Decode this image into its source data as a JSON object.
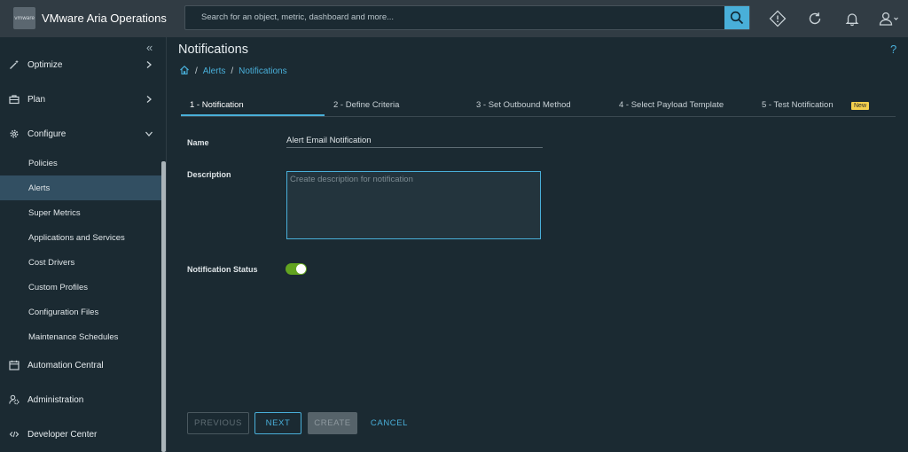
{
  "header": {
    "logo_text": "vmware",
    "app_title": "VMware Aria Operations",
    "search_placeholder": "Search for an object, metric, dashboard and more...",
    "icons": [
      "search-icon",
      "alert-diamond-icon",
      "refresh-icon",
      "bell-icon",
      "user-icon"
    ]
  },
  "sidebar": {
    "collapse_glyph": "«",
    "items": [
      {
        "label": "Optimize",
        "icon": "wand-icon",
        "chevron": "right"
      },
      {
        "label": "Plan",
        "icon": "briefcase-icon",
        "chevron": "right"
      },
      {
        "label": "Configure",
        "icon": "gear-icon",
        "chevron": "down"
      }
    ],
    "configure_children": [
      {
        "label": "Policies"
      },
      {
        "label": "Alerts",
        "active": true
      },
      {
        "label": "Super Metrics"
      },
      {
        "label": "Applications and Services"
      },
      {
        "label": "Cost Drivers"
      },
      {
        "label": "Custom Profiles"
      },
      {
        "label": "Configuration Files"
      },
      {
        "label": "Maintenance Schedules"
      }
    ],
    "bottom_items": [
      {
        "label": "Automation Central",
        "icon": "calendar-icon"
      },
      {
        "label": "Administration",
        "icon": "admin-gear-icon"
      },
      {
        "label": "Developer Center",
        "icon": "code-icon"
      }
    ]
  },
  "main": {
    "page_title": "Notifications",
    "help_glyph": "?",
    "breadcrumb": {
      "sep": "/",
      "items": [
        "Alerts",
        "Notifications"
      ]
    },
    "steps": [
      {
        "label": "1 - Notification",
        "active": true
      },
      {
        "label": "2 - Define Criteria"
      },
      {
        "label": "3 - Set Outbound Method"
      },
      {
        "label": "4 - Select Payload Template"
      },
      {
        "label": "5 - Test Notification",
        "badge": "New"
      }
    ],
    "form": {
      "name_label": "Name",
      "name_value": "Alert Email Notification",
      "description_label": "Description",
      "description_placeholder": "Create description for notification",
      "status_label": "Notification Status",
      "status_on": true
    },
    "buttons": {
      "previous": "PREVIOUS",
      "next": "NEXT",
      "create": "CREATE",
      "cancel": "CANCEL"
    }
  },
  "colors": {
    "accent": "#49afd9",
    "toggle_on": "#62a420",
    "badge": "#f4d04d",
    "active_row": "#324f62"
  }
}
